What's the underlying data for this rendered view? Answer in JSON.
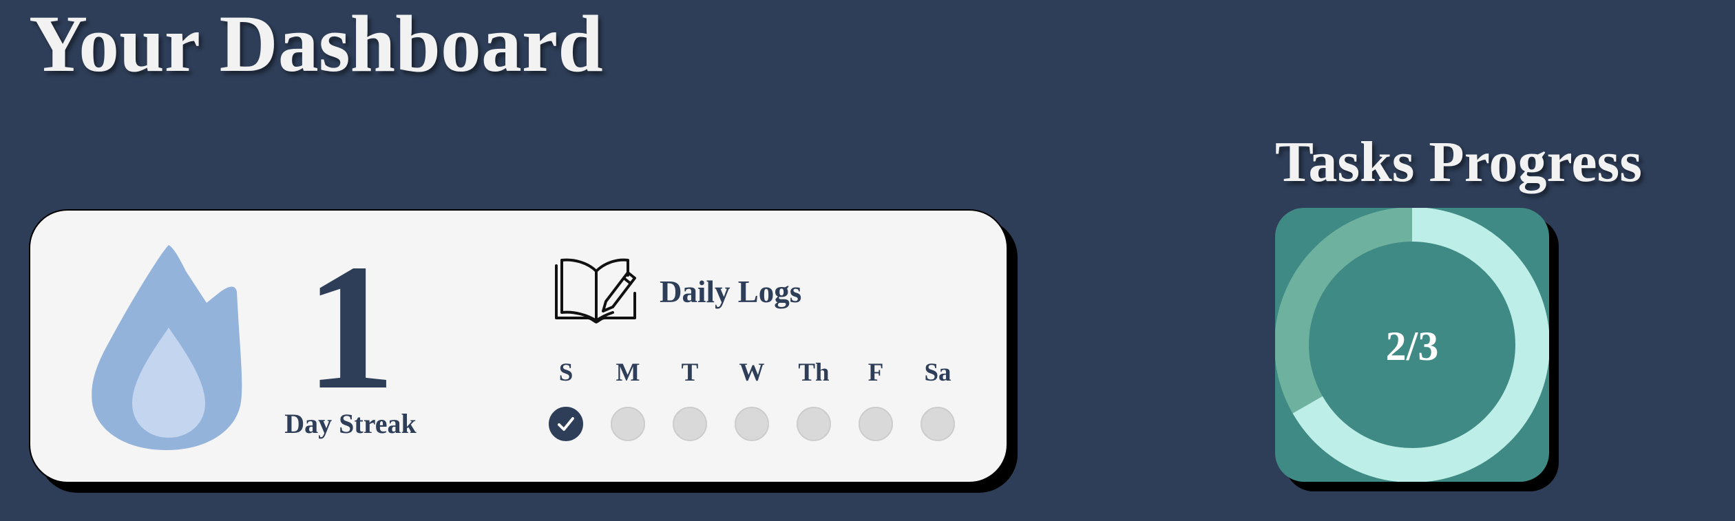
{
  "page": {
    "title": "Your Dashboard"
  },
  "streak": {
    "count": "1",
    "label": "Day Streak",
    "icon": "flame-icon"
  },
  "daily_logs": {
    "title": "Daily Logs",
    "icon": "book-pencil-icon",
    "days": [
      {
        "label": "S",
        "done": true
      },
      {
        "label": "M",
        "done": false
      },
      {
        "label": "T",
        "done": false
      },
      {
        "label": "W",
        "done": false
      },
      {
        "label": "Th",
        "done": false
      },
      {
        "label": "F",
        "done": false
      },
      {
        "label": "Sa",
        "done": false
      }
    ]
  },
  "tasks_progress": {
    "title": "Tasks Progress",
    "completed": 2,
    "total": 3,
    "label": "2/3"
  },
  "colors": {
    "background": "#2e3e58",
    "card": "#f5f5f5",
    "accent_navy": "#2e3e58",
    "flame_outer": "#94b3db",
    "flame_inner": "#c3d5ef",
    "progress_bg": "#3f8a84",
    "progress_done": "#bdeee8",
    "progress_remaining": "#6fb19f",
    "dot_empty": "#d9d9d9"
  }
}
